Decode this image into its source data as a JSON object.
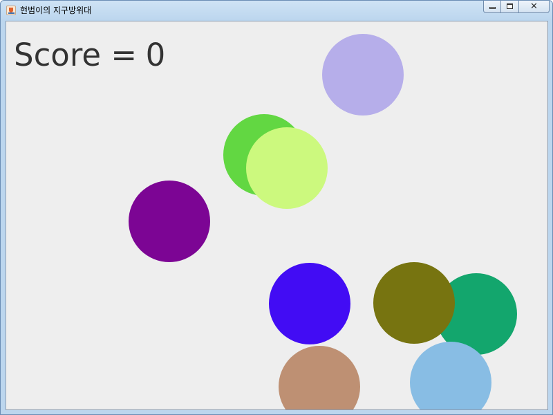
{
  "window": {
    "title": "현범이의 지구방위대",
    "icon": "java-cup-icon",
    "controls": {
      "minimize_icon": "minimize-icon",
      "maximize_icon": "maximize-icon",
      "close_icon": "close-icon",
      "close_glyph": "✕"
    }
  },
  "game": {
    "background_color": "#eeeeee",
    "score_label": "Score =",
    "score_value": "0",
    "ball_colors": [
      "#b6aeea",
      "#62d742",
      "#ccf97e",
      "#7c0594",
      "#420cf4",
      "#13a66d",
      "#777410",
      "#be9073",
      "#88bde4"
    ]
  }
}
